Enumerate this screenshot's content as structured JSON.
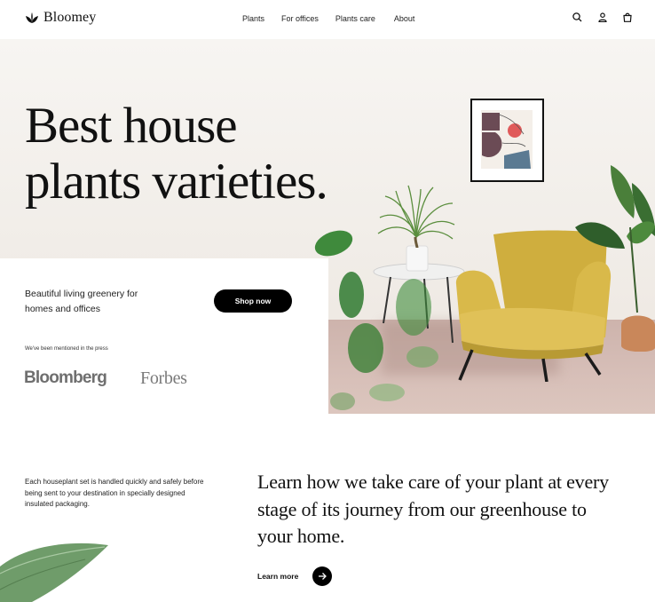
{
  "header": {
    "brand": "Bloomey",
    "nav": [
      "Plants",
      "For offices",
      "Plants care",
      "About"
    ],
    "icons": [
      "search-icon",
      "user-icon",
      "shopping-bag-icon"
    ]
  },
  "hero": {
    "headline_line1": "Best house",
    "headline_line2": "plants varieties.",
    "tagline": "Beautiful living greenery for homes and offices",
    "shop_button": "Shop now",
    "press_label": "We've been mentioned in the press",
    "press_logos": [
      "Bloomberg",
      "Forbes"
    ]
  },
  "lower": {
    "description": "Each houseplant set is handled quickly and safely before being sent to your destination in specially designed insulated packaging.",
    "headline": "Learn how we take care of your plant at every stage of its journey from our greenhouse to your home.",
    "learn_more": "Learn more"
  },
  "colors": {
    "accent": "#000000",
    "chair": "#d9b94a",
    "leaf": "#3f7a3a",
    "floor": "#d3bab3"
  }
}
